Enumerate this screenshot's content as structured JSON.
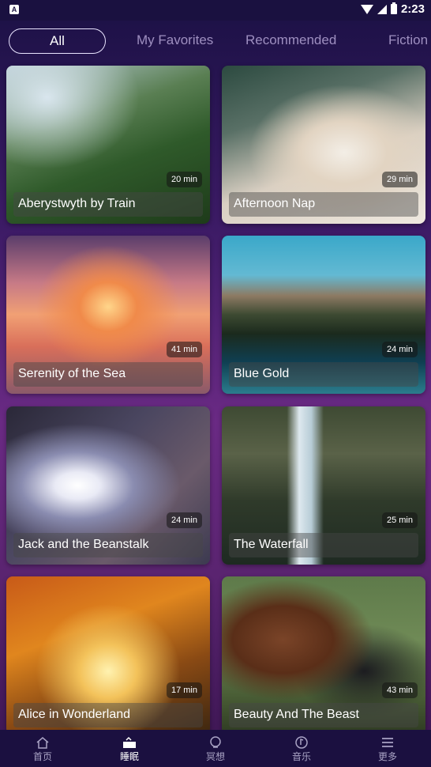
{
  "status": {
    "time": "2:23"
  },
  "tabs": [
    {
      "label": "All"
    },
    {
      "label": "My Favorites"
    },
    {
      "label": "Recommended"
    },
    {
      "label": "Fiction"
    }
  ],
  "cards": [
    {
      "title": "Aberystwyth by Train",
      "duration": "20 min"
    },
    {
      "title": "Afternoon Nap",
      "duration": "29 min"
    },
    {
      "title": "Serenity of the Sea",
      "duration": "41 min"
    },
    {
      "title": "Blue Gold",
      "duration": "24 min"
    },
    {
      "title": "Jack and the Beanstalk",
      "duration": "24 min"
    },
    {
      "title": "The Waterfall",
      "duration": "25 min"
    },
    {
      "title": "Alice in Wonderland",
      "duration": "17 min"
    },
    {
      "title": "Beauty And The Beast",
      "duration": "43 min"
    }
  ],
  "nav": [
    {
      "label": "首页",
      "icon": "home-icon"
    },
    {
      "label": "睡眠",
      "icon": "sleep-icon"
    },
    {
      "label": "冥想",
      "icon": "meditation-icon"
    },
    {
      "label": "音乐",
      "icon": "music-icon"
    },
    {
      "label": "更多",
      "icon": "more-icon"
    }
  ]
}
